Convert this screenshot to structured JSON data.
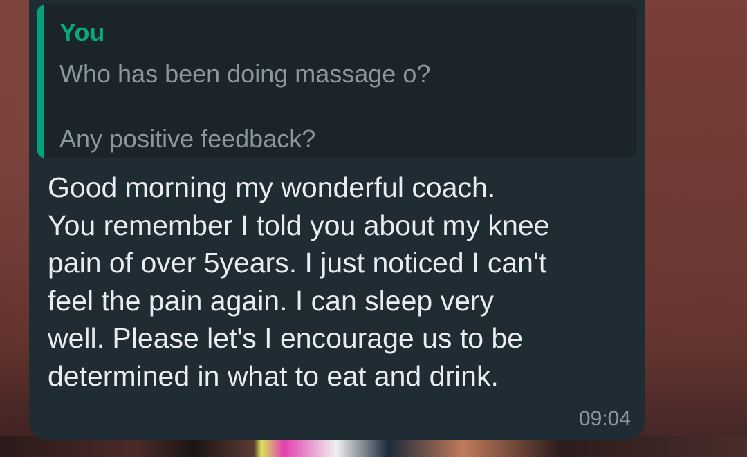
{
  "quoted_message": {
    "sender": "You",
    "text": "Who has been doing massage o?\n\nAny positive feedback?",
    "accent_color": "#06a17c"
  },
  "message": {
    "text": "Good morning my wonderful coach.\nYou remember I told you about my knee\npain of over 5years.  I just noticed I can't\nfeel the pain again. I can sleep very\nwell. Please let's I encourage us to be\ndetermined in what to eat and drink.",
    "time": "09:04"
  },
  "colors": {
    "bubble": "#202c33",
    "quote_background": "#1a242a",
    "message_text": "#e9edef",
    "meta_text": "#8d989f"
  }
}
